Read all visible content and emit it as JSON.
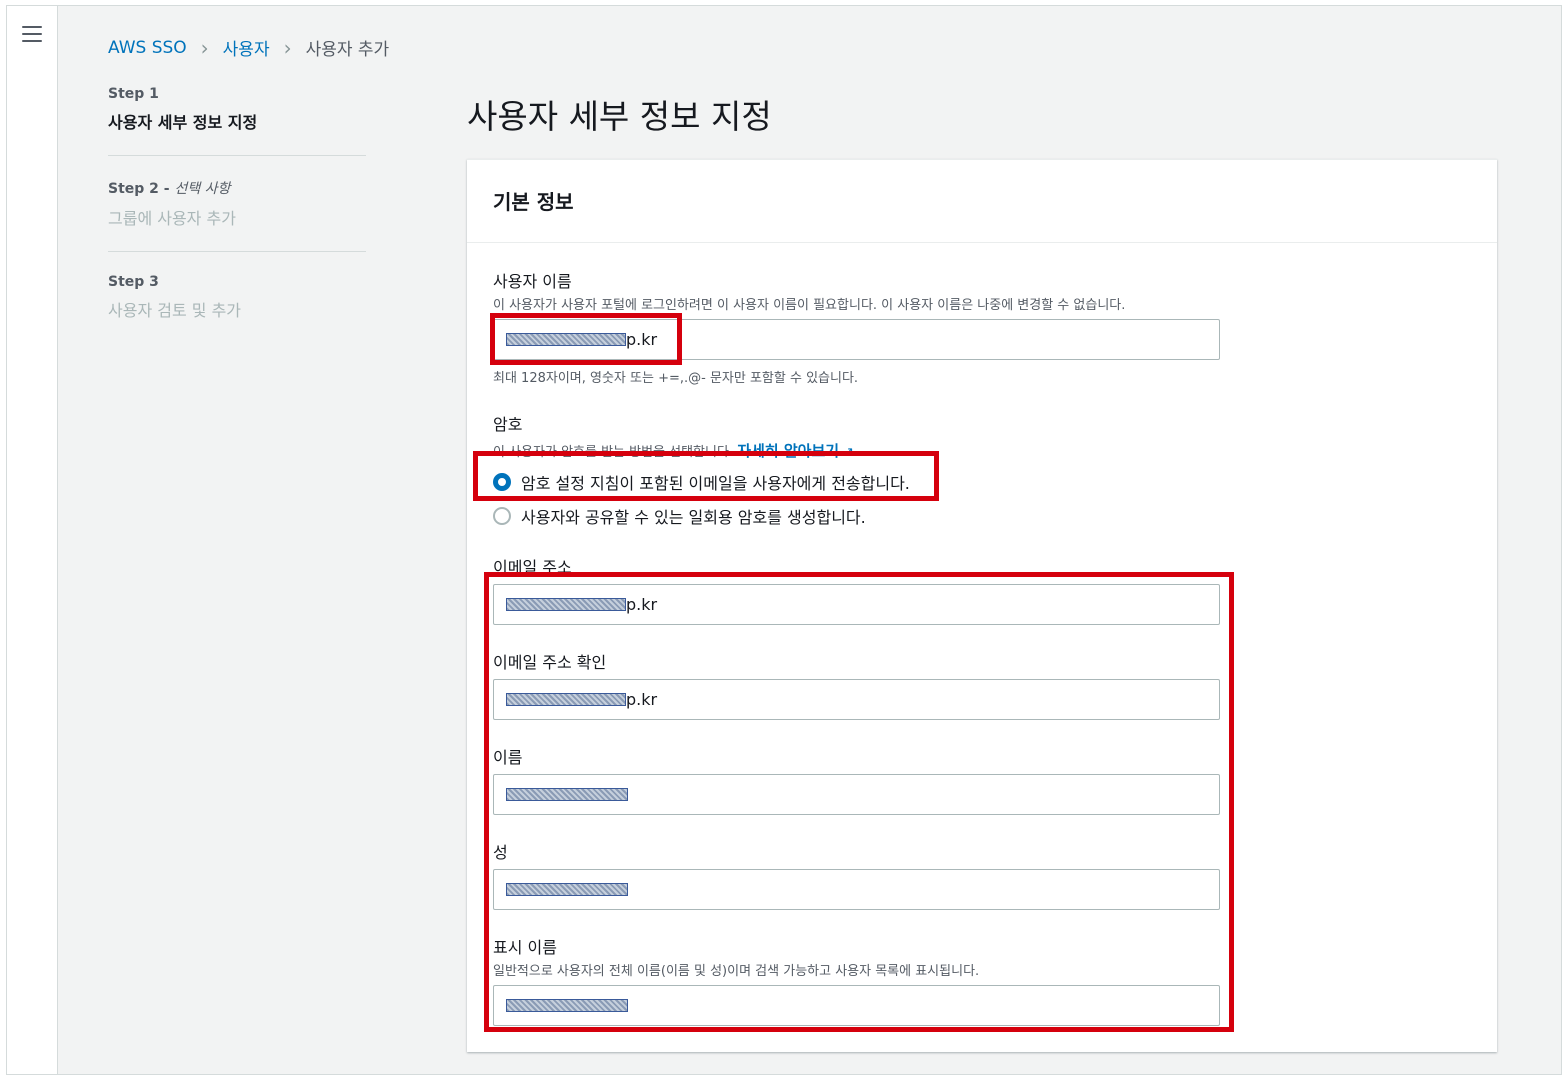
{
  "nav": {
    "menu_icon": "hamburger-menu-icon"
  },
  "breadcrumb": {
    "items": [
      "AWS SSO",
      "사용자",
      "사용자 추가"
    ],
    "separator": ">"
  },
  "steps": [
    {
      "num": "Step 1",
      "optional": "",
      "title": "사용자 세부 정보 지정"
    },
    {
      "num": "Step 2 - ",
      "optional": "선택 사항",
      "title": "그룹에 사용자 추가"
    },
    {
      "num": "Step 3",
      "optional": "",
      "title": "사용자 검토 및 추가"
    }
  ],
  "page": {
    "title": "사용자 세부 정보 지정"
  },
  "panel": {
    "header": "기본 정보",
    "username": {
      "label": "사용자 이름",
      "description": "이 사용자가 사용자 포털에 로그인하려면 이 사용자 이름이 필요합니다. 이 사용자 이름은 나중에 변경할 수 없습니다.",
      "value_suffix": "p.kr",
      "hint": "최대 128자이며, 영숫자 또는 +=,.@- 문자만 포함할 수 있습니다."
    },
    "password": {
      "label": "암호",
      "description": "이 사용자가 암호를 받는 방법을 선택합니다.",
      "learn_more": "자세히 알아보기",
      "options": [
        {
          "label": "암호 설정 지침이 포함된 이메일을 사용자에게 전송합니다.",
          "checked": true
        },
        {
          "label": "사용자와 공유할 수 있는 일회용 암호를 생성합니다.",
          "checked": false
        }
      ]
    },
    "email": {
      "label": "이메일 주소",
      "value_suffix": "p.kr"
    },
    "email_confirm": {
      "label": "이메일 주소 확인",
      "value_suffix": "p.kr"
    },
    "first_name": {
      "label": "이름",
      "value_suffix": ""
    },
    "last_name": {
      "label": "성",
      "value_suffix": ""
    },
    "display_name": {
      "label": "표시 이름",
      "description": "일반적으로 사용자의 전체 이름(이름 및 성)이며 검색 가능하고 사용자 목록에 표시됩니다.",
      "value_suffix": ""
    }
  },
  "colors": {
    "accent": "#0073bb",
    "highlight": "#d5000d"
  }
}
